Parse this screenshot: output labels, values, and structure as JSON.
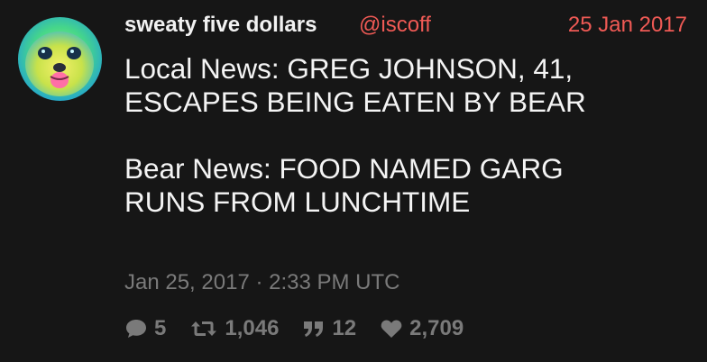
{
  "author": {
    "display_name": "sweaty five dollars",
    "handle": "@iscoff"
  },
  "date_short": "25 Jan 2017",
  "tweet_text": {
    "paragraph1_line1": "Local News: GREG JOHNSON, 41,",
    "paragraph1_line2": "ESCAPES BEING EATEN BY BEAR",
    "paragraph2_line1": "Bear News: FOOD NAMED GARG",
    "paragraph2_line2": "RUNS FROM LUNCHTIME"
  },
  "timestamp": "Jan 25, 2017 · 2:33 PM UTC",
  "stats": {
    "replies": "5",
    "retweets": "1,046",
    "quotes": "12",
    "likes": "2,709"
  },
  "icons": {
    "reply": "comment-icon",
    "retweet": "retweet-icon",
    "quote": "quote-icon",
    "like": "heart-icon"
  },
  "colors": {
    "background": "#161616",
    "accent": "#f05a55",
    "muted": "#7a7a7a",
    "text": "#f2f2f2"
  }
}
